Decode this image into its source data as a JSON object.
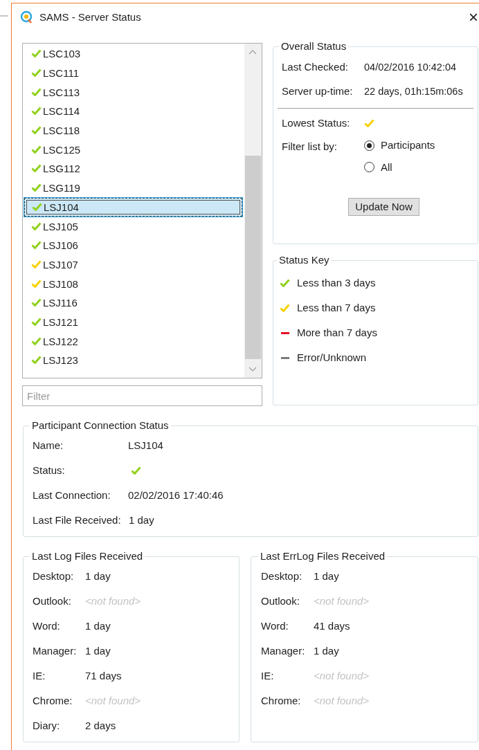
{
  "window": {
    "title": "SAMS - Server Status",
    "close": "×"
  },
  "participants": [
    {
      "name": "LSC103",
      "color": "#8fd11b",
      "selected": false
    },
    {
      "name": "LSC111",
      "color": "#8fd11b",
      "selected": false
    },
    {
      "name": "LSC113",
      "color": "#8fd11b",
      "selected": false
    },
    {
      "name": "LSC114",
      "color": "#8fd11b",
      "selected": false
    },
    {
      "name": "LSC118",
      "color": "#8fd11b",
      "selected": false
    },
    {
      "name": "LSC125",
      "color": "#8fd11b",
      "selected": false
    },
    {
      "name": "LSG112",
      "color": "#8fd11b",
      "selected": false
    },
    {
      "name": "LSG119",
      "color": "#8fd11b",
      "selected": false
    },
    {
      "name": "LSJ104",
      "color": "#8fd11b",
      "selected": true
    },
    {
      "name": "LSJ105",
      "color": "#8fd11b",
      "selected": false
    },
    {
      "name": "LSJ106",
      "color": "#8fd11b",
      "selected": false
    },
    {
      "name": "LSJ107",
      "color": "#f7d100",
      "selected": false
    },
    {
      "name": "LSJ108",
      "color": "#f7d100",
      "selected": false
    },
    {
      "name": "LSJ116",
      "color": "#8fd11b",
      "selected": false
    },
    {
      "name": "LSJ121",
      "color": "#8fd11b",
      "selected": false
    },
    {
      "name": "LSJ122",
      "color": "#8fd11b",
      "selected": false
    },
    {
      "name": "LSJ123",
      "color": "#8fd11b",
      "selected": false
    }
  ],
  "filter": {
    "placeholder": "Filter"
  },
  "overall_status": {
    "title": "Overall Status",
    "last_checked": {
      "label": "Last Checked:",
      "value": "04/02/2016 10:42:04"
    },
    "uptime": {
      "label": "Server up-time:",
      "value": "22 days, 01h:15m:06s"
    },
    "lowest_status": {
      "label": "Lowest Status:",
      "color": "#f7d100"
    },
    "filter_by": {
      "label": "Filter list by:",
      "options": [
        {
          "label": "Participants",
          "selected": true
        },
        {
          "label": "All",
          "selected": false
        }
      ]
    },
    "update_button": "Update Now"
  },
  "status_key": {
    "title": "Status Key",
    "items": [
      {
        "kind": "check",
        "color": "#8fd11b",
        "label": "Less than 3 days"
      },
      {
        "kind": "check",
        "color": "#f7d100",
        "label": "Less than 7 days"
      },
      {
        "kind": "dash",
        "color": "#e81123",
        "label": "More than 7 days"
      },
      {
        "kind": "dash",
        "color": "#7a7a7a",
        "label": "Error/Unknown"
      }
    ]
  },
  "connection_status": {
    "title": "Participant Connection Status",
    "name": {
      "label": "Name:",
      "value": "LSJ104"
    },
    "status": {
      "label": "Status:",
      "color": "#8fd11b"
    },
    "last_connection": {
      "label": "Last Connection:",
      "value": "02/02/2016 17:40:46"
    },
    "last_file": {
      "label": "Last File Received:",
      "value": "1 day"
    }
  },
  "log_files": {
    "title": "Last Log Files Received",
    "rows": [
      {
        "label": "Desktop:",
        "value": "1 day",
        "found": true
      },
      {
        "label": "Outlook:",
        "value": "<not found>",
        "found": false
      },
      {
        "label": "Word:",
        "value": "1 day",
        "found": true
      },
      {
        "label": "Manager:",
        "value": "1 day",
        "found": true
      },
      {
        "label": "IE:",
        "value": "71 days",
        "found": true
      },
      {
        "label": "Chrome:",
        "value": "<not found>",
        "found": false
      },
      {
        "label": "Diary:",
        "value": "2 days",
        "found": true
      }
    ]
  },
  "errlog_files": {
    "title": "Last ErrLog Files Received",
    "rows": [
      {
        "label": "Desktop:",
        "value": "1 day",
        "found": true
      },
      {
        "label": "Outlook:",
        "value": "<not found>",
        "found": false
      },
      {
        "label": "Word:",
        "value": "41 days",
        "found": true
      },
      {
        "label": "Manager:",
        "value": "1 day",
        "found": true
      },
      {
        "label": "IE:",
        "value": "<not found>",
        "found": false
      },
      {
        "label": "Chrome:",
        "value": "<not found>",
        "found": false
      }
    ]
  }
}
